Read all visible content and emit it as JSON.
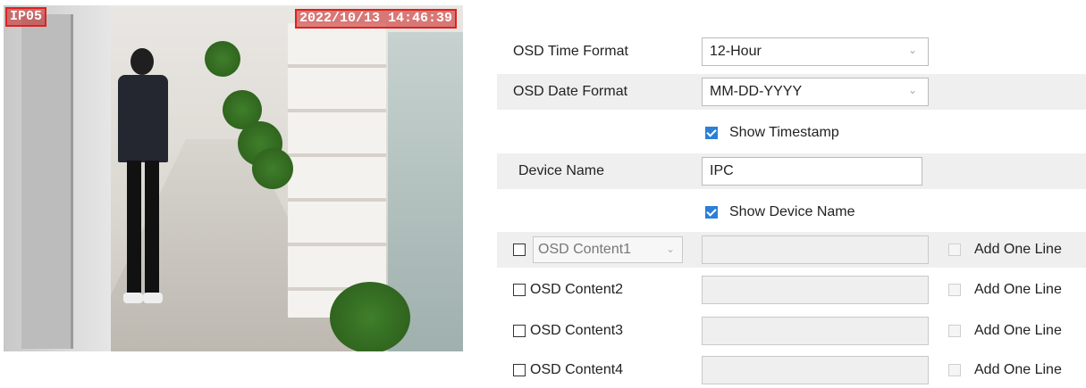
{
  "preview": {
    "osd_name": "IP05",
    "osd_timestamp": "2022/10/13 14:46:39"
  },
  "settings": {
    "time_format": {
      "label": "OSD Time Format",
      "value": "12-Hour"
    },
    "date_format": {
      "label": "OSD Date Format",
      "value": "MM-DD-YYYY"
    },
    "show_timestamp": {
      "label": "Show Timestamp",
      "checked": true
    },
    "device_name": {
      "label": "Device Name",
      "value": "IPC"
    },
    "show_device_name": {
      "label": "Show Device Name",
      "checked": true
    },
    "osd_contents": [
      {
        "label": "OSD Content1",
        "value": "",
        "add_one_line": "Add One Line"
      },
      {
        "label": "OSD Content2",
        "value": "",
        "add_one_line": "Add One Line"
      },
      {
        "label": "OSD Content3",
        "value": "",
        "add_one_line": "Add One Line"
      },
      {
        "label": "OSD Content4",
        "value": "",
        "add_one_line": "Add One Line"
      }
    ]
  },
  "colors": {
    "accent": "#2b7fd6",
    "osd_border": "#e02020",
    "row_shade": "#efefef"
  },
  "icons": {
    "dropdown": "chevron-down-icon",
    "check": "checkbox-checked-icon"
  }
}
